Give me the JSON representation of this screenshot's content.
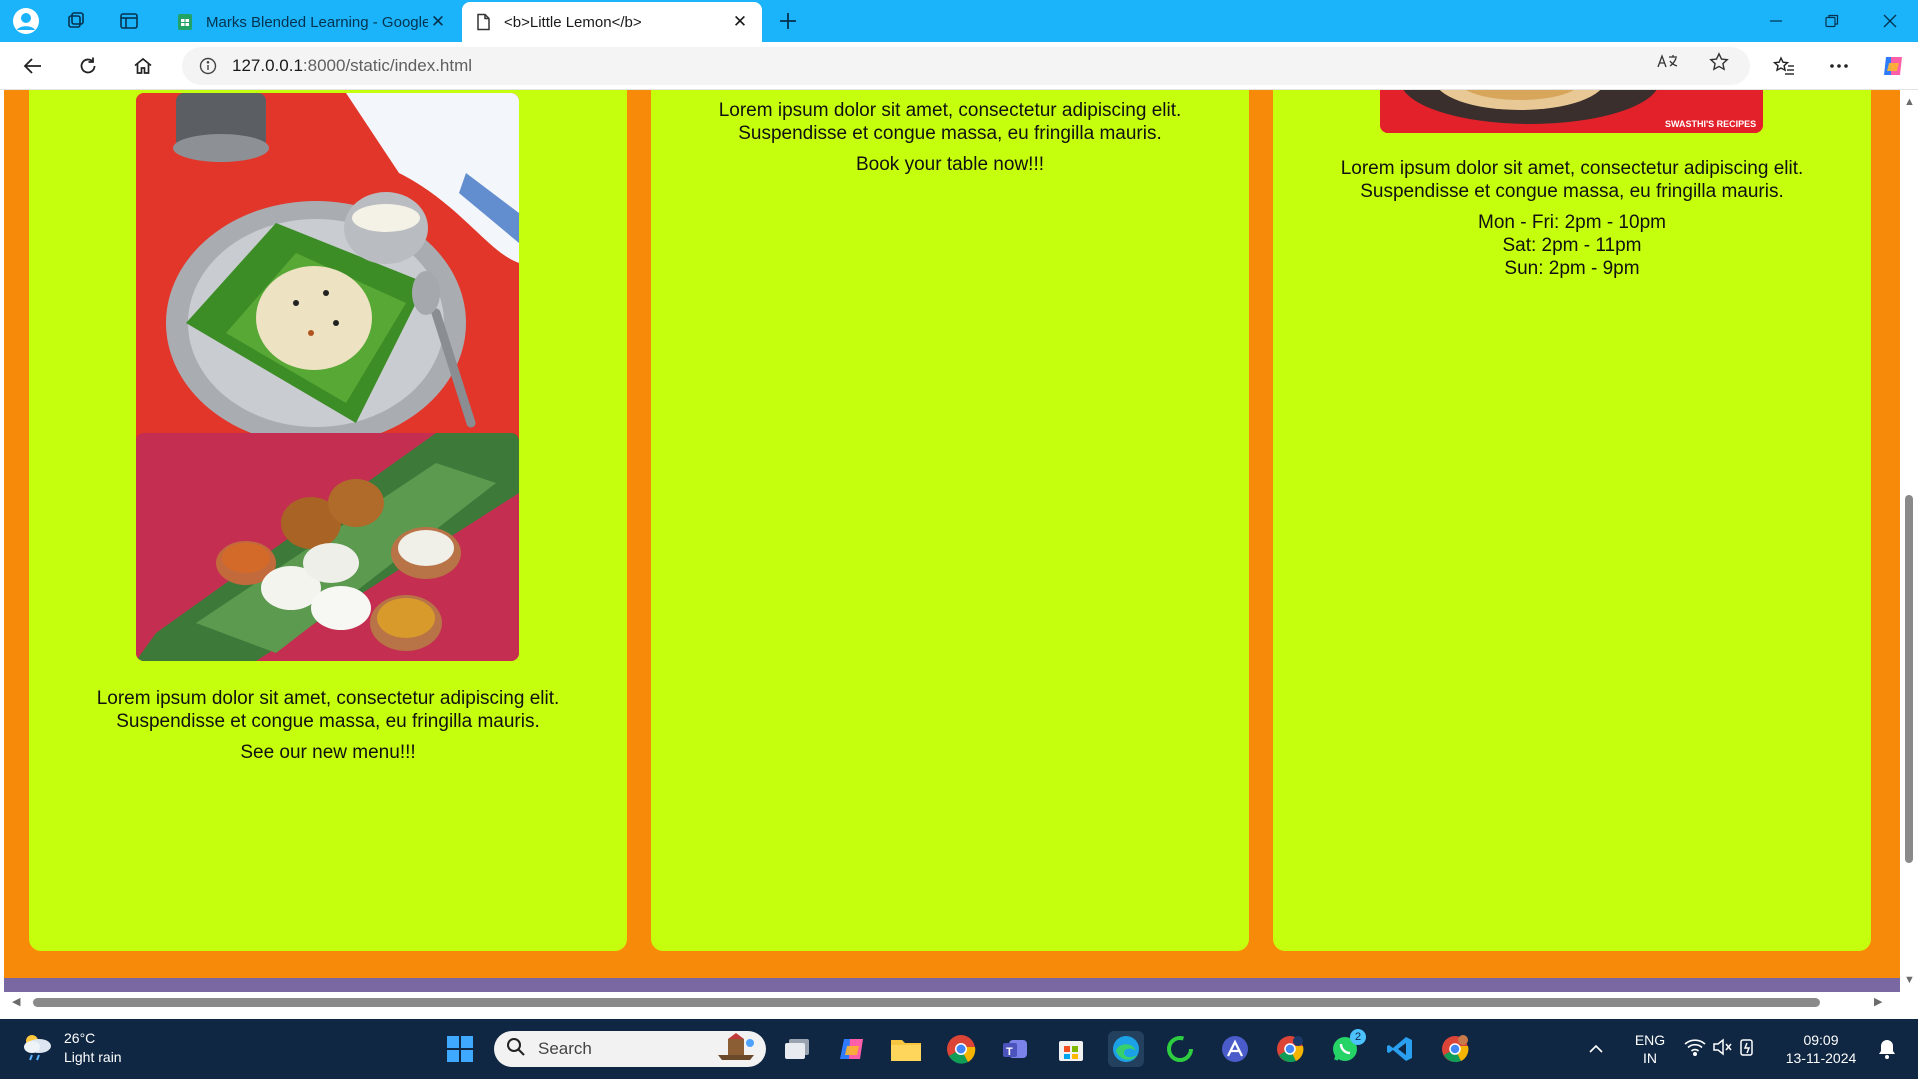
{
  "tabs": [
    {
      "title": "Marks Blended Learning - Google",
      "state": "inactive"
    },
    {
      "title": "<b>Little Lemon</b>",
      "state": "active"
    }
  ],
  "address": {
    "host": "127.0.0.1",
    "rest": ":8000/static/index.html"
  },
  "page": {
    "colors": {
      "background": "#f78a09",
      "card": "#c6ff0e",
      "footer_strip": "#7a68a2"
    },
    "left_card": {
      "lorem_line1": "Lorem ipsum dolor sit amet, consectetur adipiscing elit.",
      "lorem_line2": "Suspendisse et congue massa, eu fringilla mauris.",
      "cta": "See our new menu!!!"
    },
    "middle_card": {
      "lorem_line1": "Lorem ipsum dolor sit amet, consectetur adipiscing elit.",
      "lorem_line2": "Suspendisse et congue massa, eu fringilla mauris.",
      "cta": "Book your table now!!!"
    },
    "right_card": {
      "image_watermark": "SWASTHI'S RECIPES",
      "lorem_line1": "Lorem ipsum dolor sit amet, consectetur adipiscing elit.",
      "lorem_line2": "Suspendisse et congue massa, eu fringilla mauris.",
      "hours": [
        "Mon - Fri: 2pm - 10pm",
        "Sat: 2pm - 11pm",
        "Sun: 2pm - 9pm"
      ]
    }
  },
  "taskbar": {
    "weather": {
      "temp": "26°C",
      "condition": "Light rain"
    },
    "search_label": "Search",
    "lang": {
      "line1": "ENG",
      "line2": "IN"
    },
    "clock": {
      "time": "09:09",
      "date": "13-11-2024"
    },
    "whatsapp_badge": "2"
  }
}
